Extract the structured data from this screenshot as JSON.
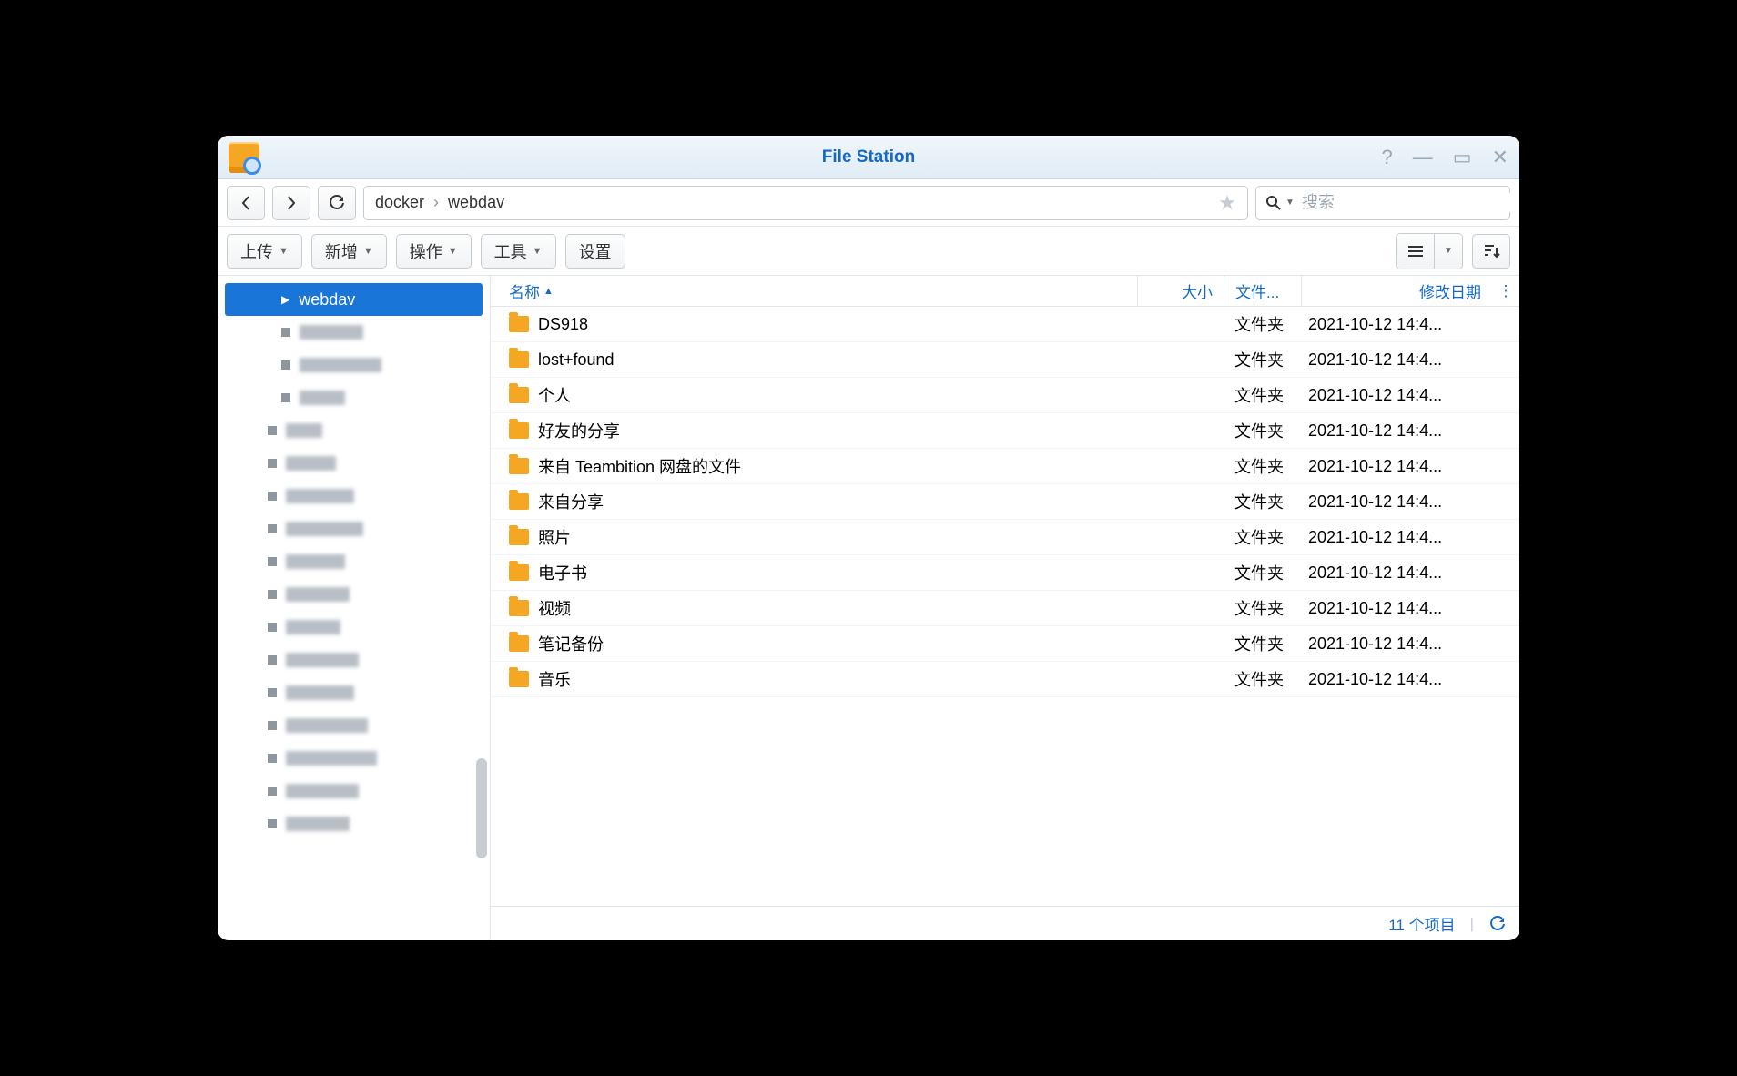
{
  "window": {
    "title": "File Station"
  },
  "breadcrumb": {
    "parts": [
      "docker",
      "webdav"
    ]
  },
  "search": {
    "placeholder": "搜索"
  },
  "toolbar": {
    "upload": "上传",
    "create": "新增",
    "action": "操作",
    "tools": "工具",
    "settings": "设置"
  },
  "sidebar": {
    "selected": "webdav"
  },
  "columns": {
    "name": "名称",
    "size": "大小",
    "type": "文件...",
    "modified": "修改日期"
  },
  "files": [
    {
      "name": "DS918",
      "type": "文件夹",
      "modified": "2021-10-12 14:4..."
    },
    {
      "name": "lost+found",
      "type": "文件夹",
      "modified": "2021-10-12 14:4..."
    },
    {
      "name": "个人",
      "type": "文件夹",
      "modified": "2021-10-12 14:4..."
    },
    {
      "name": "好友的分享",
      "type": "文件夹",
      "modified": "2021-10-12 14:4..."
    },
    {
      "name": "来自 Teambition 网盘的文件",
      "type": "文件夹",
      "modified": "2021-10-12 14:4..."
    },
    {
      "name": "来自分享",
      "type": "文件夹",
      "modified": "2021-10-12 14:4..."
    },
    {
      "name": "照片",
      "type": "文件夹",
      "modified": "2021-10-12 14:4..."
    },
    {
      "name": "电子书",
      "type": "文件夹",
      "modified": "2021-10-12 14:4..."
    },
    {
      "name": "视频",
      "type": "文件夹",
      "modified": "2021-10-12 14:4..."
    },
    {
      "name": "笔记备份",
      "type": "文件夹",
      "modified": "2021-10-12 14:4..."
    },
    {
      "name": "音乐",
      "type": "文件夹",
      "modified": "2021-10-12 14:4..."
    }
  ],
  "status": {
    "count": "11 个项目"
  }
}
